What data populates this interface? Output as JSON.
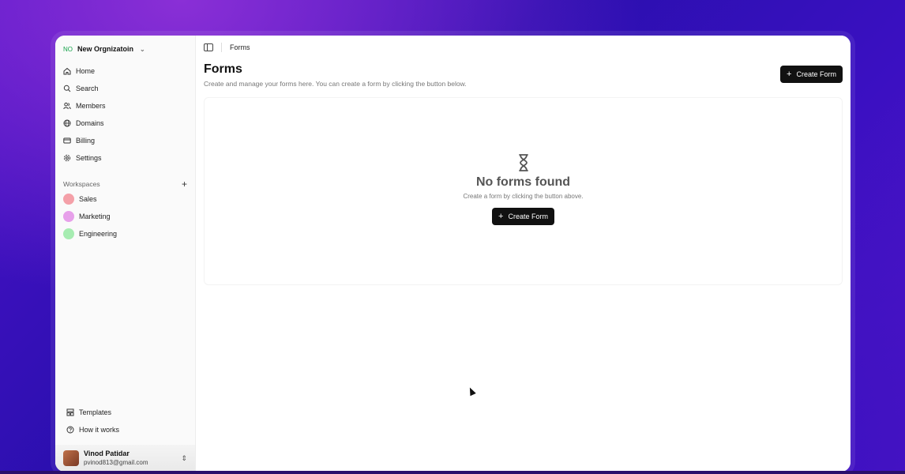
{
  "org": {
    "initials": "NO",
    "name": "New Orgnizatoin"
  },
  "nav": [
    {
      "label": "Home",
      "icon": "home-icon"
    },
    {
      "label": "Search",
      "icon": "search-icon"
    },
    {
      "label": "Members",
      "icon": "users-icon"
    },
    {
      "label": "Domains",
      "icon": "globe-icon"
    },
    {
      "label": "Billing",
      "icon": "credit-card-icon"
    },
    {
      "label": "Settings",
      "icon": "gear-icon"
    }
  ],
  "workspaces": {
    "heading": "Workspaces",
    "items": [
      {
        "label": "Sales",
        "color": "#f4a0a8"
      },
      {
        "label": "Marketing",
        "color": "#e7a0ea"
      },
      {
        "label": "Engineering",
        "color": "#a6ecb1"
      }
    ]
  },
  "bottom_links": [
    {
      "label": "Templates",
      "icon": "template-icon"
    },
    {
      "label": "How it works",
      "icon": "help-circle-icon"
    }
  ],
  "user": {
    "name": "Vinod Patidar",
    "email": "pvinod813@gmail.com"
  },
  "breadcrumb": "Forms",
  "page": {
    "title": "Forms",
    "description": "Create and manage your forms here. You can create a form by clicking the button below.",
    "create_button": "Create Form"
  },
  "empty_state": {
    "title": "No forms found",
    "subtitle": "Create a form by clicking the button above.",
    "button": "Create Form"
  },
  "colors": {
    "accent_dark": "#111111",
    "org_initials": "#16a34a"
  }
}
